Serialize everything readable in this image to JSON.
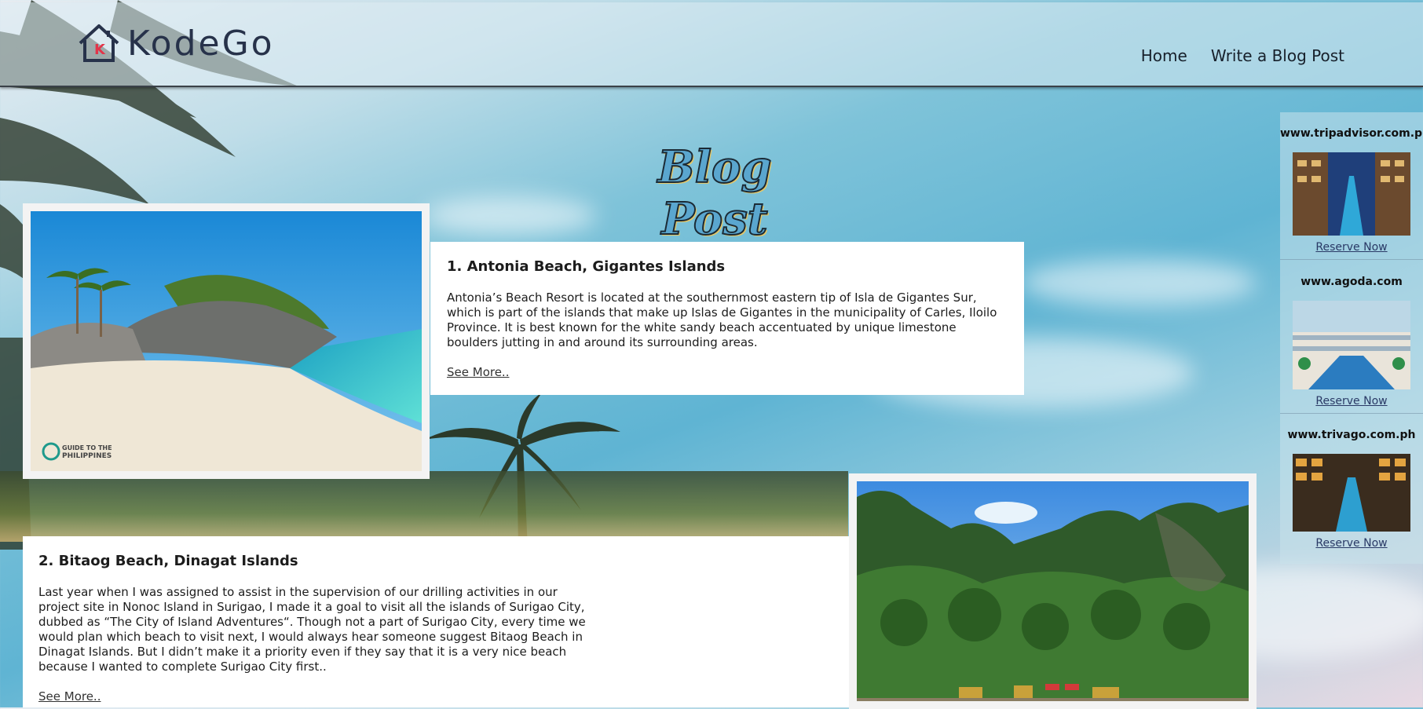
{
  "brand": {
    "name": "KodeGo",
    "logo_letter": "K"
  },
  "nav": {
    "items": [
      {
        "label": "Home"
      },
      {
        "label": "Write a Blog Post"
      }
    ]
  },
  "page": {
    "title": "Blog Post"
  },
  "posts": [
    {
      "title": "1. Antonia Beach, Gigantes Islands",
      "body": "Antonia’s Beach Resort is located at the southernmost eastern tip of Isla de Gigantes Sur, which is part of the islands that make up Islas de Gigantes in the municipality of Carles, Iloilo Province. It is best known for the white sandy beach accentuated by unique limestone boulders jutting in and around its surrounding areas.",
      "link": "See More..",
      "watermark": "GUIDE TO THE PHILIPPINES"
    },
    {
      "title": "2. Bitaog Beach, Dinagat Islands",
      "body": "Last year when I was assigned to assist in the supervision of our drilling activities in our project site in Nonoc Island in Surigao, I made it a goal to visit all the islands of Surigao City, dubbed as “The City of Island Adventures“. Though not a part of Surigao City, every time we would plan which beach to visit next, I would always hear someone suggest Bitaog Beach in Dinagat Islands. But I didn’t make it a priority even if they say that it is a very nice beach because I wanted to complete Surigao City first..",
      "link": "See More.."
    }
  ],
  "ads": [
    {
      "site": "www.tripadvisor.com.ph",
      "link": "Reserve Now"
    },
    {
      "site": "www.agoda.com",
      "link": "Reserve Now"
    },
    {
      "site": "www.trivago.com.ph",
      "link": "Reserve Now"
    }
  ],
  "colors": {
    "nav_text": "#17202b",
    "brand": "#27324a",
    "logo_accent": "#e2354a",
    "link": "#2a3a66"
  }
}
